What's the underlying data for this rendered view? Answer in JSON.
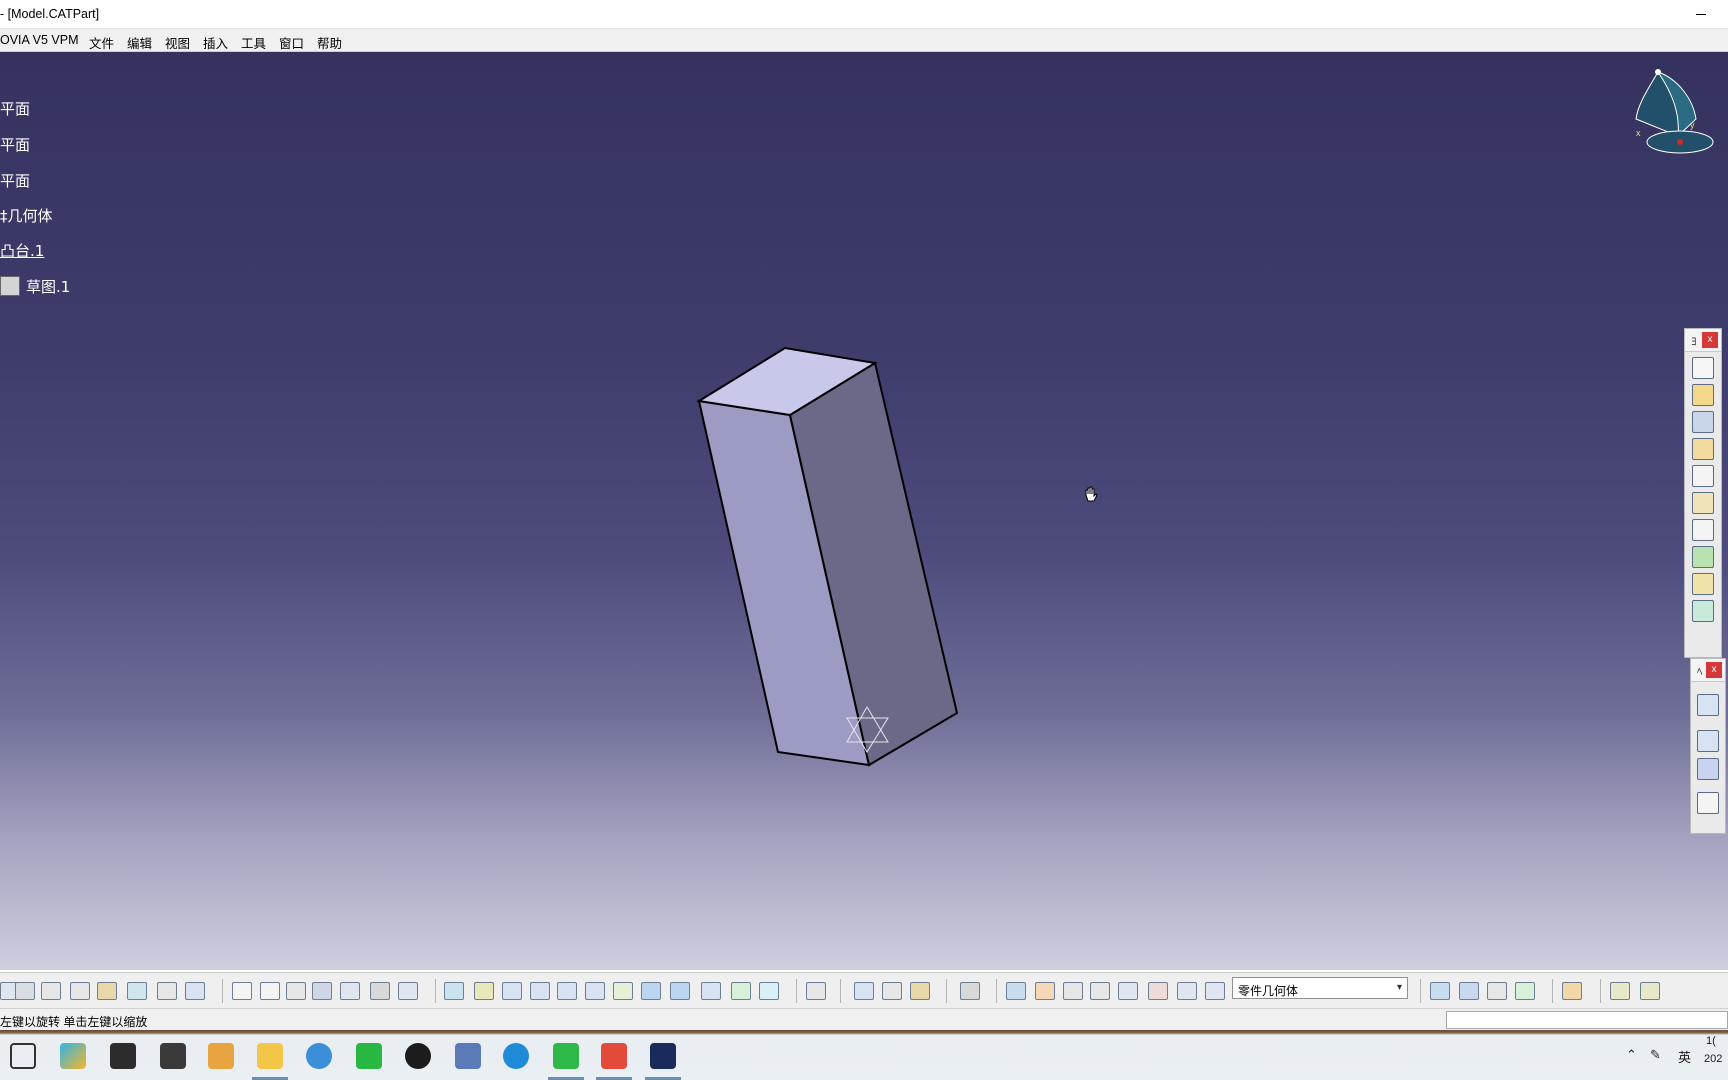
{
  "window": {
    "title": "- [Model.CATPart]"
  },
  "menu": {
    "app": "OVIA V5 VPM",
    "file": "文件",
    "edit": "编辑",
    "view": "视图",
    "insert": "插入",
    "tools": "工具",
    "window": "窗口",
    "help": "帮助"
  },
  "tree": {
    "nodes": [
      "平面",
      "平面",
      "平面",
      "‡几何体",
      "凸台.1",
      "草图.1"
    ]
  },
  "side_toolbars": {
    "top": {
      "label": "ﾖ",
      "close": "x"
    },
    "bottom": {
      "label": "ﾍ",
      "close": "x"
    }
  },
  "toolbar": {
    "body_select": {
      "value": "零件几何体",
      "arrow": "▾"
    }
  },
  "status": {
    "message": "左键以旋转  单击左键以缩放"
  },
  "taskbar": {
    "input_method": "英",
    "clock_line1": "1(",
    "clock_line2": "202"
  },
  "colors": {
    "viewport_top": "#35325f",
    "viewport_bottom": "#cfcfe0",
    "part_front": "#9b9bc4",
    "part_right": "#6a6a88",
    "part_top": "#c8c8ea"
  },
  "icons": {
    "compass": "compass-icon",
    "cursor": "hand-cursor-icon",
    "sketch": "sketch-icon"
  }
}
